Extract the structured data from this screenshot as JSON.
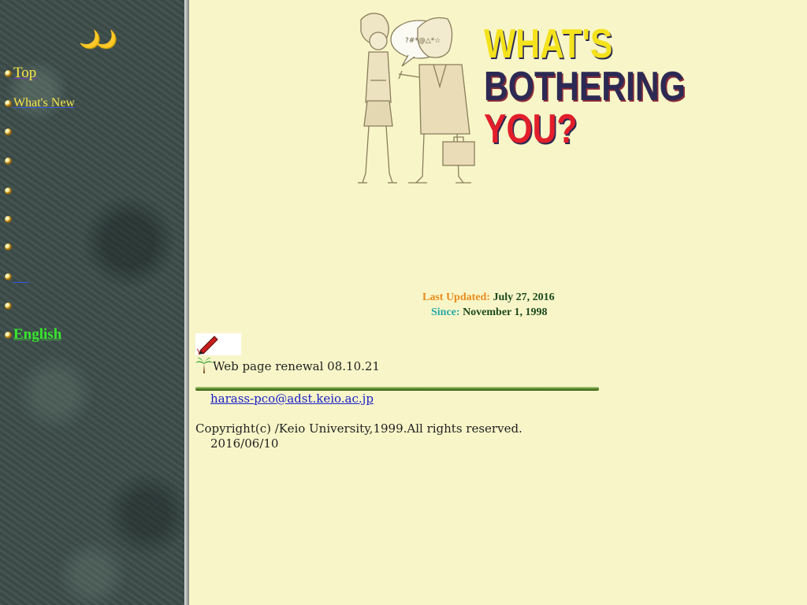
{
  "sidebar": {
    "moons": "🌙🌙",
    "items": [
      {
        "label": "Top"
      },
      {
        "label": "What's New"
      },
      {
        "label": ""
      },
      {
        "label": ""
      },
      {
        "label": ""
      },
      {
        "label": ""
      },
      {
        "label": ""
      },
      {
        "label": ""
      },
      {
        "label": ""
      },
      {
        "label": "English"
      }
    ]
  },
  "header": {
    "line1": "WHAT'S",
    "line2": "BOTHERING",
    "line3": "YOU?",
    "speech_bubble": "?#*@△*☆"
  },
  "updates": {
    "last_updated_label": "Last Updated:",
    "last_updated_value": "July 27, 2016",
    "since_label": "Since:",
    "since_value": "November 1, 1998"
  },
  "main": {
    "renewal_text": "Web page renewal 08.10.21",
    "email": "harass-pco@adst.keio.ac.jp",
    "copyright": "Copyright(c) /Keio University,1999.All rights reserved.",
    "date": "2016/06/10"
  },
  "colors": {
    "page_background": "#f8f6c8",
    "sidebar_background": "#3d4d4a",
    "link_blue": "#1a20c8",
    "headline_yellow": "#f4e21c",
    "headline_navy": "#2c2a54",
    "headline_red": "#e21e2a"
  },
  "icons": [
    "moon-icon",
    "bullet-icon",
    "pen-icon",
    "palm-tree-icon"
  ]
}
